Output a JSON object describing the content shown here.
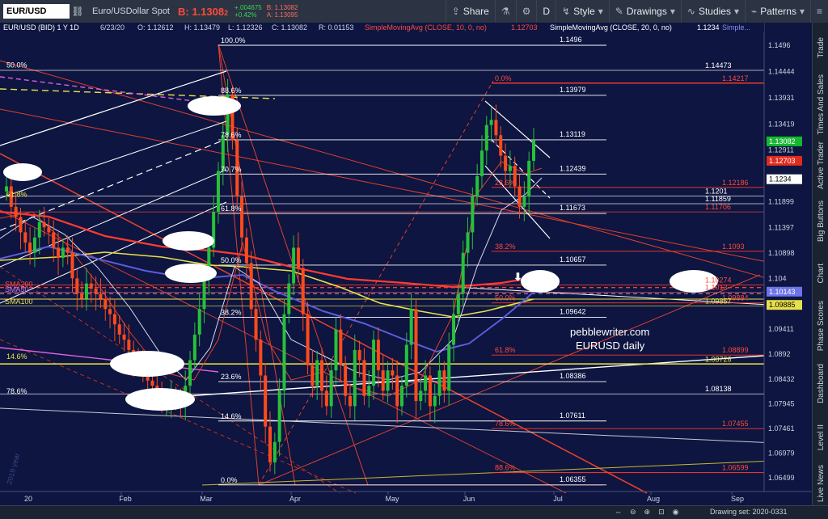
{
  "toolbar": {
    "symbol": "EUR/USD",
    "description": "Euro/USDollar Spot",
    "last_prefix": "B:",
    "last": "1.1308",
    "last_sub": "2",
    "change": "+.004675",
    "change_pct": "+0.42%",
    "bid": "B: 1.13082",
    "ask": "A: 1.13095",
    "share_label": "Share",
    "period_label": "D",
    "style_label": "Style",
    "drawings_label": "Drawings",
    "studies_label": "Studies",
    "patterns_label": "Patterns"
  },
  "chart_header": {
    "symbol_line": "EUR/USD (BID) 1 Y 1D",
    "date": "6/23/20",
    "open": "O: 1.1261",
    "open_sub": "2",
    "high": "H: 1.13479",
    "low": "L: 1.1232",
    "low_sub": "6",
    "close": "C: 1.1308",
    "close_sub": "2",
    "range": "R: 0.0115",
    "range_sub": "3",
    "sma10_label": "SimpleMovingAvg (CLOSE, 10, 0, no)",
    "sma10_value": "1.1270",
    "sma10_sub": "3",
    "sma20_label": "SimpleMovingAvg (CLOSE, 20, 0, no)",
    "sma20_value": "1.1234",
    "more": "Simple..."
  },
  "chart_data": {
    "type": "candlestick",
    "ylim": [
      1.063,
      1.1525
    ],
    "y_ticks": [
      "1.1496",
      "1.14444",
      "1.13931",
      "1.13419",
      "1.12911",
      "1.11899",
      "1.11397",
      "1.10898",
      "1.104",
      "1.09411",
      "1.0892",
      "1.08432",
      "1.07945",
      "1.07461",
      "1.06979",
      "1.06499"
    ],
    "x_ticks": [
      "20",
      "Feb",
      "Mar",
      "Apr",
      "May",
      "Jun",
      "Jul",
      "Aug",
      "Sep"
    ],
    "price_tags": [
      {
        "label": "1.1308",
        "sub": "2",
        "value": 1.1308,
        "color": "#16b82f",
        "text_color": "#ffffff"
      },
      {
        "label": "1.1270",
        "sub": "3",
        "value": 1.127,
        "color": "#e02b20",
        "text_color": "#ffffff"
      },
      {
        "label": "1.1234",
        "sub": "",
        "value": 1.1234,
        "color": "#ffffff",
        "text_color": "#000000"
      },
      {
        "label": "1.1014",
        "sub": "3",
        "value": 1.1014,
        "color": "#6d73e8",
        "text_color": "#ffffff"
      },
      {
        "label": "1.0988",
        "sub": "5",
        "value": 1.0988,
        "color": "#e8e04a",
        "text_color": "#000000"
      }
    ],
    "fib_left_white": [
      {
        "label": "100.0%",
        "value": 1.1496,
        "price": "1.1496"
      },
      {
        "label": "88.6%",
        "value": 1.1398,
        "price": "1.1397",
        "price_sub": "9"
      },
      {
        "label": "78.6%",
        "value": 1.1311,
        "price": "1.1311",
        "price_sub": "9"
      },
      {
        "label": "70.7%",
        "value": 1.1244,
        "price": "1.1243",
        "price_sub": "9"
      },
      {
        "label": "61.8%",
        "value": 1.1167,
        "price": "1.1167",
        "price_sub": "3"
      },
      {
        "label": "50.0%",
        "value": 1.1066,
        "price": "1.1065",
        "price_sub": "7"
      },
      {
        "label": "38.2%",
        "value": 1.0964,
        "price": "1.0964",
        "price_sub": "2"
      },
      {
        "label": "23.6%",
        "value": 1.0838,
        "price": "1.0838",
        "price_sub": "6"
      },
      {
        "label": "14.6%",
        "value": 1.0761,
        "price": "1.0761",
        "price_sub": "1"
      },
      {
        "label": "0.0%",
        "value": 1.0636,
        "price": "1.0635",
        "price_sub": "5"
      }
    ],
    "fib_right_red": [
      {
        "label": "0.0%",
        "value": 1.1422,
        "price": "1.1421",
        "price_sub": "7"
      },
      {
        "label": "23.6%",
        "value": 1.1218,
        "price": "1.1218",
        "price_sub": "6"
      },
      {
        "label": "38.2%",
        "value": 1.1093,
        "price": "1.1093"
      },
      {
        "label": "50.0%",
        "value": 1.0992,
        "price": "1.0988",
        "price_sub": "4"
      },
      {
        "label": "61.8%",
        "value": 1.089,
        "price": "1.0889",
        "price_sub": "9"
      },
      {
        "label": "78.6%",
        "value": 1.0746,
        "price": "1.0745",
        "price_sub": "5"
      },
      {
        "label": "88.6%",
        "value": 1.066,
        "price": "1.0659",
        "price_sub": "9"
      }
    ],
    "extra_levels": [
      {
        "price": "1.1447",
        "sub": "3",
        "value": 1.1447,
        "color": "#ffffff"
      },
      {
        "price": "1.1201",
        "sub": "",
        "value": 1.1201,
        "color": "#ffffff"
      },
      {
        "price": "1.1185",
        "sub": "9",
        "value": 1.1186,
        "color": "#ffffff"
      },
      {
        "price": "1.1170",
        "sub": "6",
        "value": 1.117,
        "color": "#ff4a3c"
      },
      {
        "price": "1.1027",
        "sub": "4",
        "value": 1.1027,
        "color": "#ff4a3c"
      },
      {
        "price": "1.1013",
        "sub": "",
        "value": 1.1013,
        "color": "#ff4a3c"
      },
      {
        "price": "1.0985",
        "sub": "7",
        "value": 1.0986,
        "color": "#e8e04a"
      },
      {
        "price": "1.0872",
        "sub": "6",
        "value": 1.0872,
        "color": "#e8e04a"
      },
      {
        "price": "1.0813",
        "sub": "8",
        "value": 1.0814,
        "color": "#ffffff"
      }
    ],
    "left_fib_labels": [
      {
        "label": "50.0%",
        "color": "#ffffff",
        "value": 1.1448
      },
      {
        "label": "61.8%",
        "color": "#e8e04a",
        "value": 1.1195
      },
      {
        "label": "14.6%",
        "color": "#e8e04a",
        "value": 1.0878
      },
      {
        "label": "78.6%",
        "color": "#ffffff",
        "value": 1.081
      }
    ],
    "ma_labels": [
      {
        "label": "SMA200",
        "color": "#ff4a3c",
        "value": 1.1022
      },
      {
        "label": "SMA50",
        "color": "#c77ff0",
        "value": 1.1012
      },
      {
        "label": "SMA100",
        "color": "#e8e04a",
        "value": 1.0988
      }
    ],
    "watermark_1": "pebblewriter.com",
    "watermark_2": "EURUSD daily",
    "year_label": "2019 year"
  },
  "sidebar": {
    "tabs": [
      "Trade",
      "Times And Sales",
      "Active Trader",
      "Big Buttons",
      "Chart",
      "Phase Scores",
      "Dashboard",
      "Level II",
      "Live News"
    ]
  },
  "bottombar": {
    "drawing_set": "Drawing set: 2020-0331"
  }
}
